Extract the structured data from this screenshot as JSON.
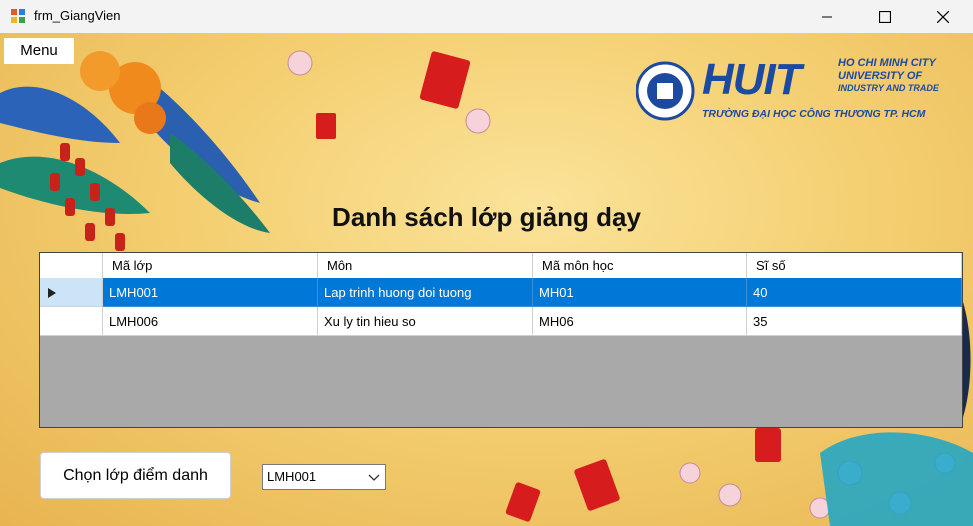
{
  "window": {
    "title": "frm_GiangVien"
  },
  "menu": {
    "label": "Menu"
  },
  "heading": "Danh sách lớp giảng dạy",
  "logo": {
    "brand": "HUIT",
    "line1": "HO CHI MINH CITY",
    "line2": "UNIVERSITY OF",
    "line3": "INDUSTRY AND TRADE",
    "line4": "TRƯỜNG ĐẠI HỌC CÔNG THƯƠNG TP. HCM"
  },
  "table": {
    "columns": [
      "Mã lớp",
      "Môn",
      "Mã môn học",
      "Sĩ số"
    ],
    "rows": [
      [
        "LMH001",
        "Lap trinh huong doi tuong",
        "MH01",
        "40"
      ],
      [
        "LMH006",
        "Xu ly tin hieu so",
        "MH06",
        "35"
      ]
    ]
  },
  "action_button": "Chọn lớp điểm danh",
  "class_select": {
    "value": "LMH001"
  },
  "colors": {
    "selection": "#0078d7",
    "brand_blue": "#1c4aa0",
    "background": "#f4cf71"
  }
}
